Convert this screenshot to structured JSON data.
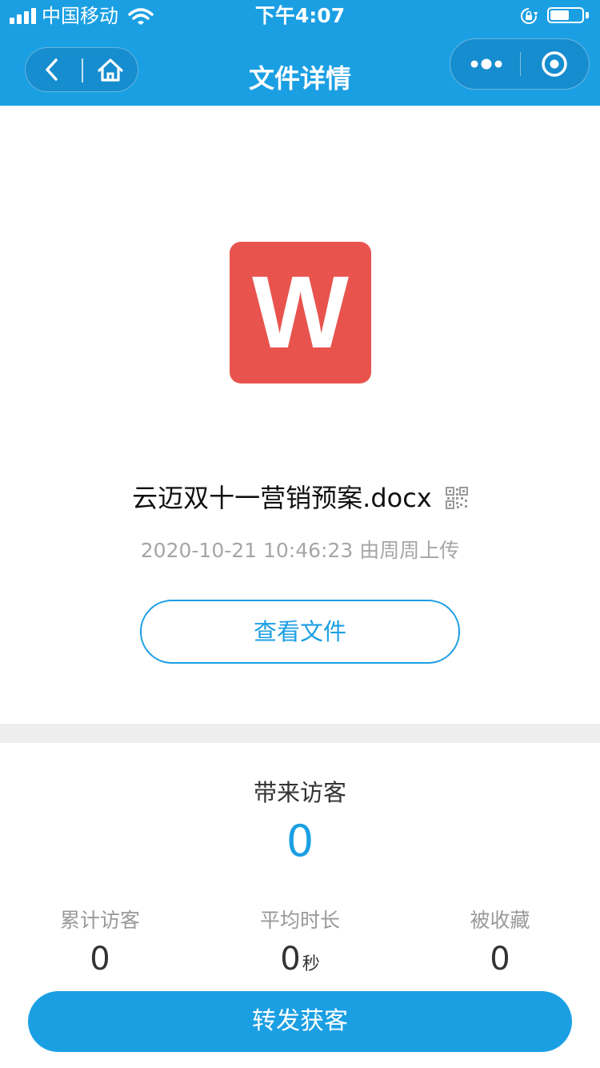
{
  "status_bar": {
    "carrier": "中国移动",
    "time": "下午4:07",
    "battery_level": 0.6
  },
  "nav": {
    "title": "文件详情"
  },
  "file": {
    "icon_letter": "W",
    "icon_color": "#e8534e",
    "name": "云迈双十一营销预案.docx",
    "upload_info": "2020-10-21 10:46:23 由周周上传",
    "view_button_label": "查看文件"
  },
  "stats": {
    "main_label": "带来访客",
    "main_value": "0",
    "items": [
      {
        "label": "累计访客",
        "value": "0",
        "unit": ""
      },
      {
        "label": "平均时长",
        "value": "0",
        "unit": "秒"
      },
      {
        "label": "被收藏",
        "value": "0",
        "unit": ""
      }
    ]
  },
  "share_button_label": "转发获客",
  "colors": {
    "accent": "#1b9fe3",
    "header_bg": "#1b9fe3",
    "divider_bg": "#eeeeee",
    "muted_text": "#a6a6a6"
  }
}
